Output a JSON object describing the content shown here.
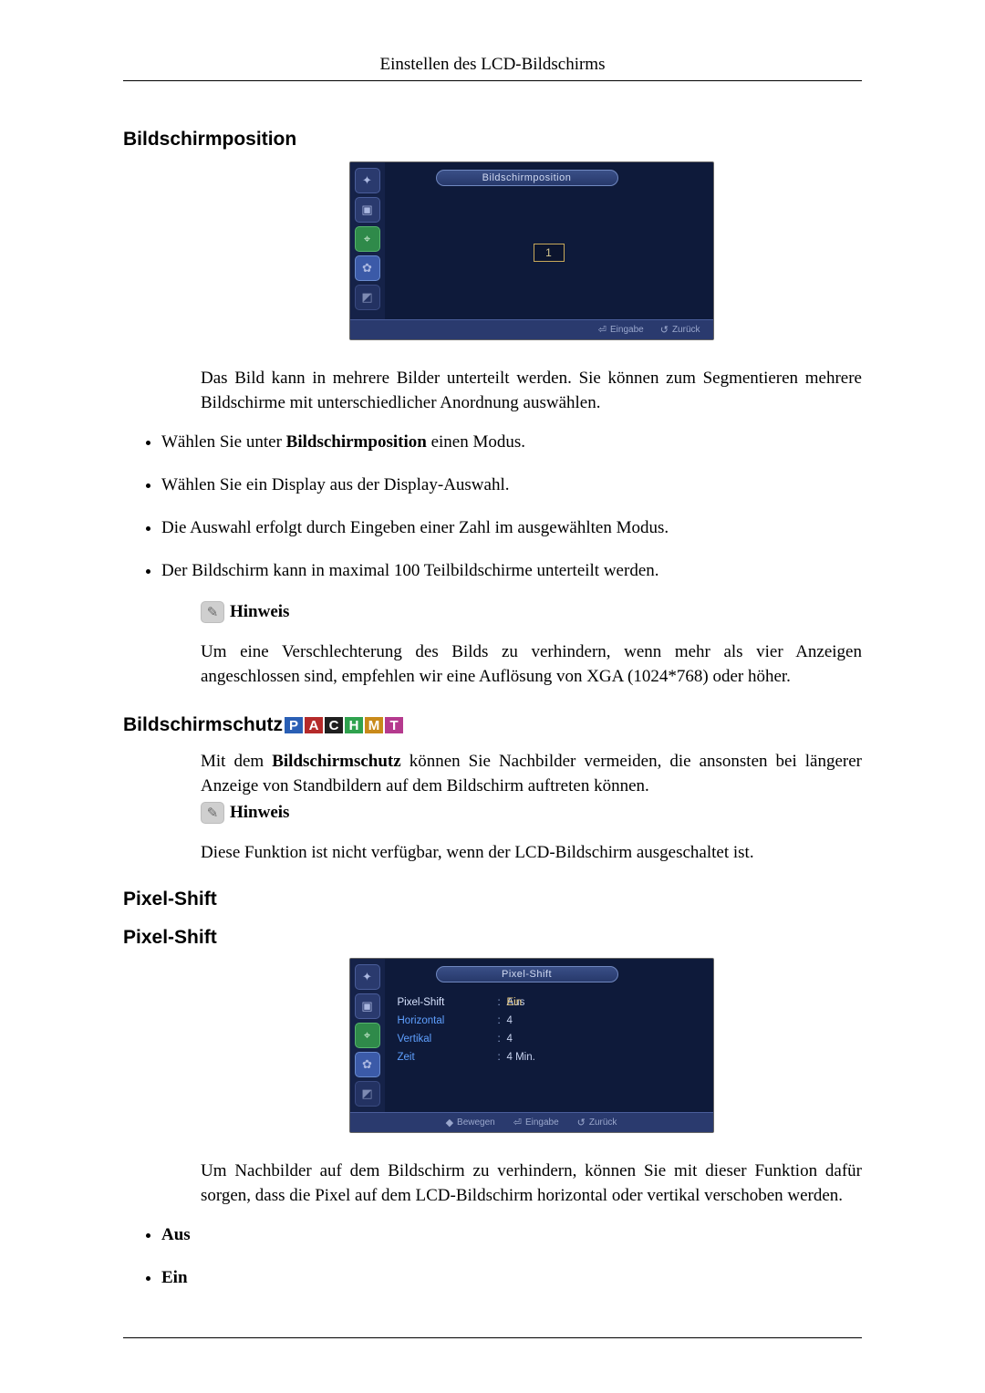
{
  "header": {
    "title": "Einstellen des LCD-Bildschirms"
  },
  "sections": {
    "bildschirmposition": {
      "heading": "Bildschirmposition",
      "osd": {
        "tab": "Bildschirmposition",
        "value": "1",
        "footer": {
          "enter_glyph": "⏎",
          "enter": "Eingabe",
          "back_glyph": "↺",
          "back": "Zurück"
        }
      },
      "intro": "Das Bild kann in mehrere Bilder unterteilt werden. Sie können zum Segmentieren mehrere Bildschirme mit unterschiedlicher Anordnung auswählen.",
      "bullets": {
        "b1_pre": "Wählen Sie unter ",
        "b1_bold": "Bildschirmposition",
        "b1_post": " einen Modus.",
        "b2": "Wählen Sie ein Display aus der Display-Auswahl.",
        "b3": "Die Auswahl erfolgt durch Eingeben einer Zahl im ausgewählten Modus.",
        "b4": "Der Bildschirm kann in maximal 100 Teilbildschirme unterteilt werden."
      },
      "note": {
        "label": "Hinweis",
        "text": "Um eine Verschlechterung des Bilds zu verhindern, wenn mehr als vier Anzeigen angeschlossen sind, empfehlen wir eine Auflösung von XGA (1024*768) oder höher."
      }
    },
    "bildschirmschutz": {
      "heading": "Bildschirmschutz",
      "modes": {
        "P": "P",
        "A": "A",
        "C": "C",
        "H": "H",
        "M": "M",
        "T": "T"
      },
      "intro_pre": "Mit dem ",
      "intro_bold": "Bildschirmschutz",
      "intro_post": " können Sie Nachbilder vermeiden, die ansonsten bei längerer Anzeige von Standbildern auf dem Bildschirm auftreten können.",
      "note": {
        "label": "Hinweis",
        "text": "Diese Funktion ist nicht verfügbar, wenn der LCD-Bildschirm ausgeschaltet ist."
      }
    },
    "pixelshift": {
      "heading1": "Pixel-Shift",
      "heading2": "Pixel-Shift",
      "osd": {
        "tab": "Pixel-Shift",
        "rows": {
          "r1": {
            "k": "Pixel-Shift",
            "aus": "Aus",
            "ein": "Ein"
          },
          "r2": {
            "k": "Horizontal",
            "v": "4"
          },
          "r3": {
            "k": "Vertikal",
            "v": "4"
          },
          "r4": {
            "k": "Zeit",
            "v": "4 Min."
          }
        },
        "footer": {
          "move_glyph": "◆",
          "move": "Bewegen",
          "enter_glyph": "⏎",
          "enter": "Eingabe",
          "back_glyph": "↺",
          "back": "Zurück"
        }
      },
      "intro": "Um Nachbilder auf dem Bildschirm zu verhindern, können Sie mit dieser Funktion dafür sorgen, dass die Pixel auf dem LCD-Bildschirm horizontal oder vertikal verschoben werden.",
      "bullets": {
        "b1": "Aus",
        "b2": "Ein"
      }
    }
  },
  "icons": {
    "note": "✎",
    "side": {
      "i1": "✦",
      "i2": "▣",
      "i3": "⌖",
      "i4": "✿",
      "i5": "◩"
    }
  }
}
